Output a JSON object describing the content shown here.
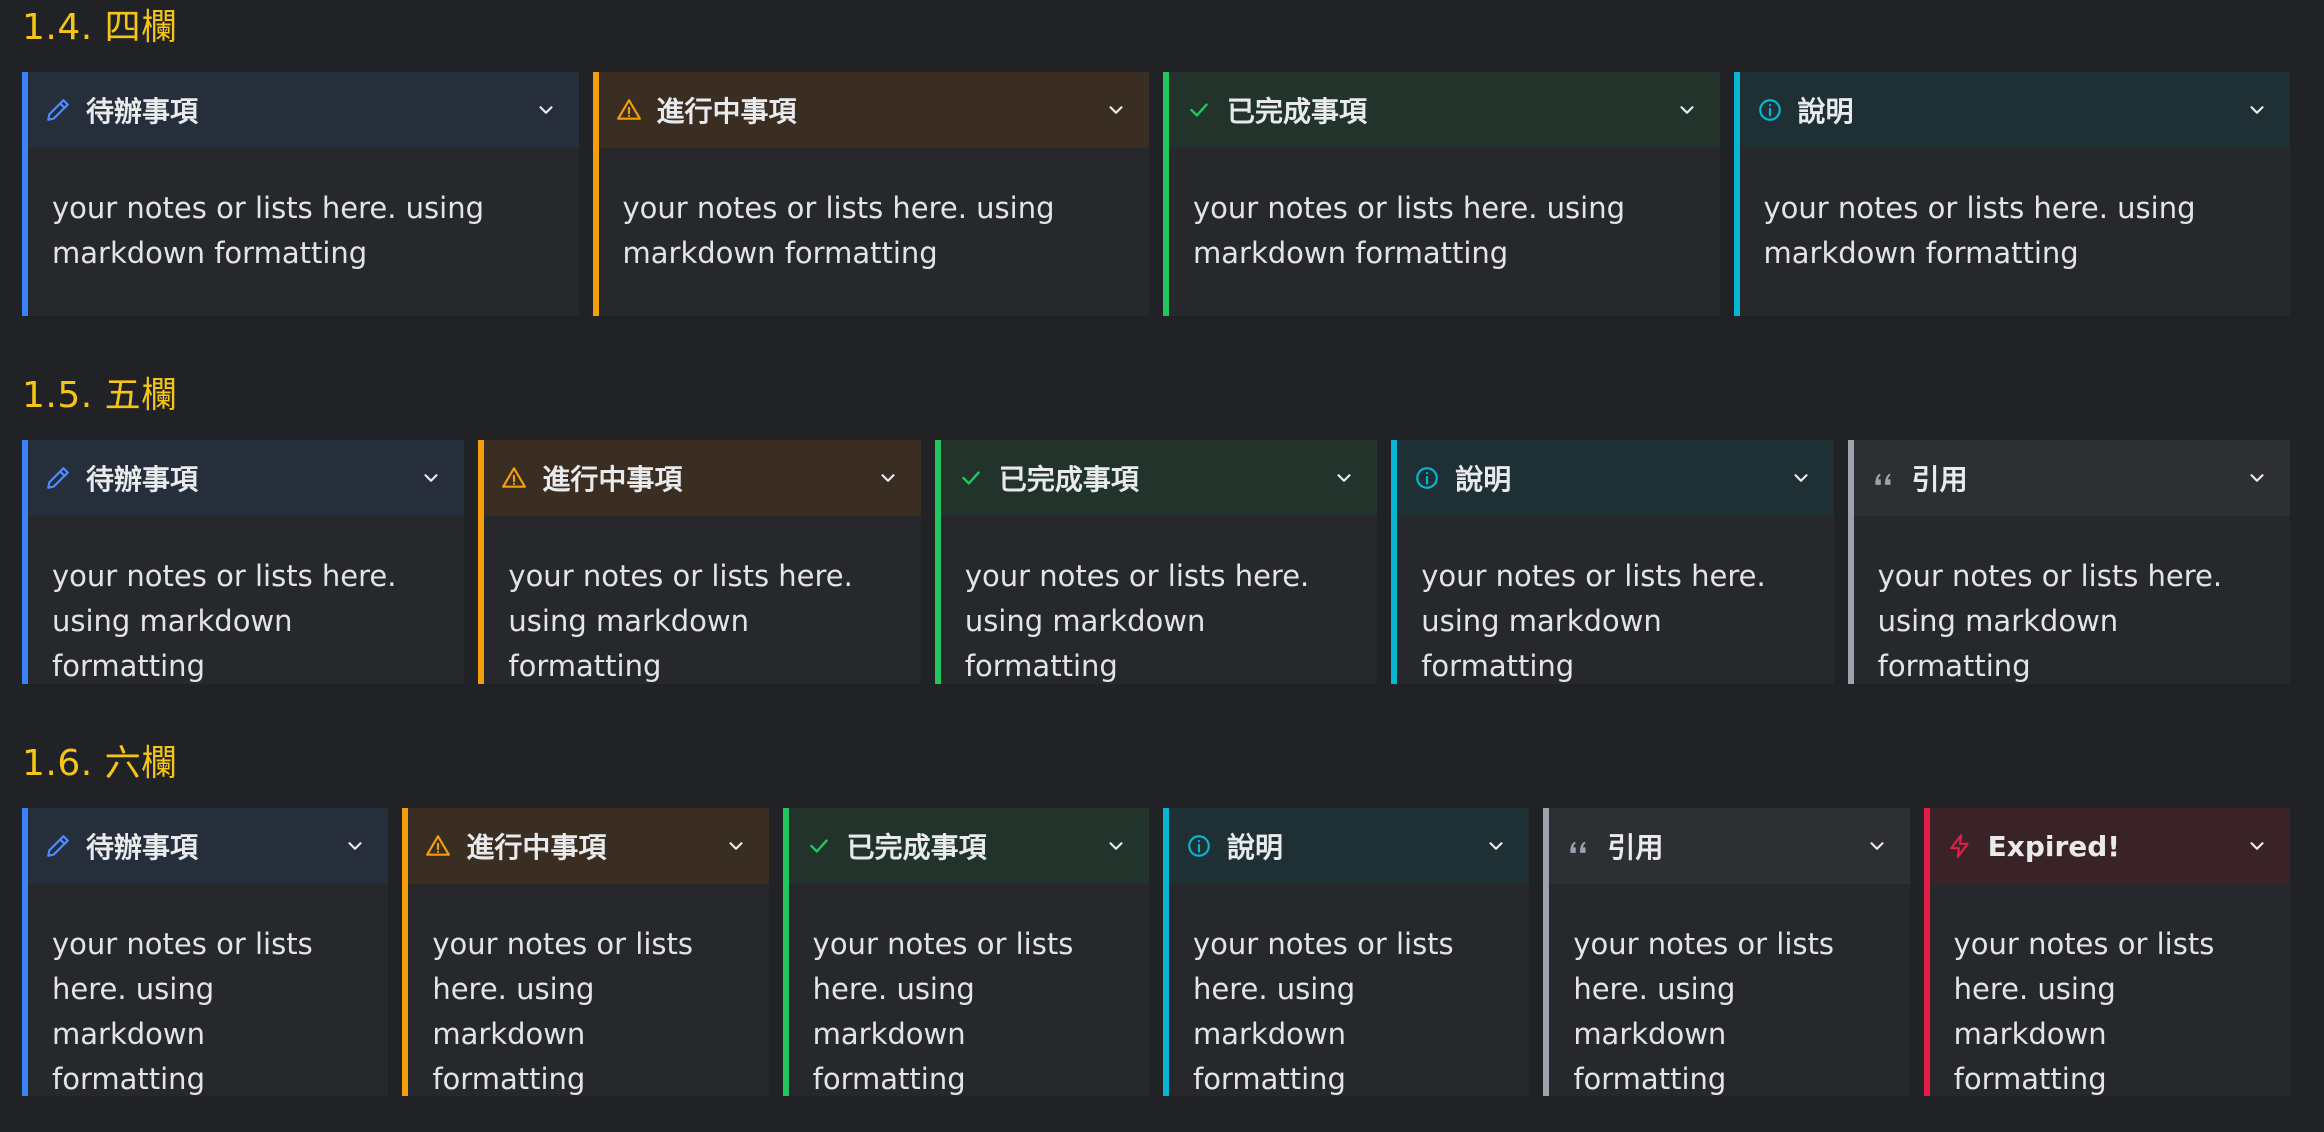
{
  "sections": [
    {
      "title": "1.4. 四欄",
      "callouts": [
        {
          "title": "待辦事項",
          "body": "your notes or lists here. using markdown formatting",
          "icon": "pencil-icon"
        },
        {
          "title": "進行中事項",
          "body": "your notes or lists here. using markdown formatting",
          "icon": "warning-icon"
        },
        {
          "title": "已完成事項",
          "body": "your notes or lists here. using markdown formatting",
          "icon": "check-icon"
        },
        {
          "title": "說明",
          "body": "your notes or lists here. using markdown formatting",
          "icon": "info-icon"
        }
      ]
    },
    {
      "title": "1.5. 五欄",
      "callouts": [
        {
          "title": "待辦事項",
          "body": "your notes or lists here. using markdown formatting",
          "icon": "pencil-icon"
        },
        {
          "title": "進行中事項",
          "body": "your notes or lists here. using markdown formatting",
          "icon": "warning-icon"
        },
        {
          "title": "已完成事項",
          "body": "your notes or lists here. using markdown formatting",
          "icon": "check-icon"
        },
        {
          "title": "說明",
          "body": "your notes or lists here. using markdown formatting",
          "icon": "info-icon"
        },
        {
          "title": "引用",
          "body": "your notes or lists here. using markdown formatting",
          "icon": "quote-icon"
        }
      ]
    },
    {
      "title": "1.6. 六欄",
      "callouts": [
        {
          "title": "待辦事項",
          "body": "your notes or lists here. using markdown formatting",
          "icon": "pencil-icon"
        },
        {
          "title": "進行中事項",
          "body": "your notes or lists here. using markdown formatting",
          "icon": "warning-icon"
        },
        {
          "title": "已完成事項",
          "body": "your notes or lists here. using markdown formatting",
          "icon": "check-icon"
        },
        {
          "title": "說明",
          "body": "your notes or lists here. using markdown formatting",
          "icon": "info-icon"
        },
        {
          "title": "引用",
          "body": "your notes or lists here. using markdown formatting",
          "icon": "quote-icon"
        },
        {
          "title": "Expired!",
          "body": "your notes or lists here. using markdown formatting",
          "icon": "bolt-icon"
        }
      ]
    }
  ],
  "colors": {
    "heading": "#f5c518",
    "todo": "#3b82f6",
    "progress": "#f59e0b",
    "done": "#22c55e",
    "info": "#06b6d4",
    "quote": "#9ca3af",
    "expired": "#e11d48"
  }
}
